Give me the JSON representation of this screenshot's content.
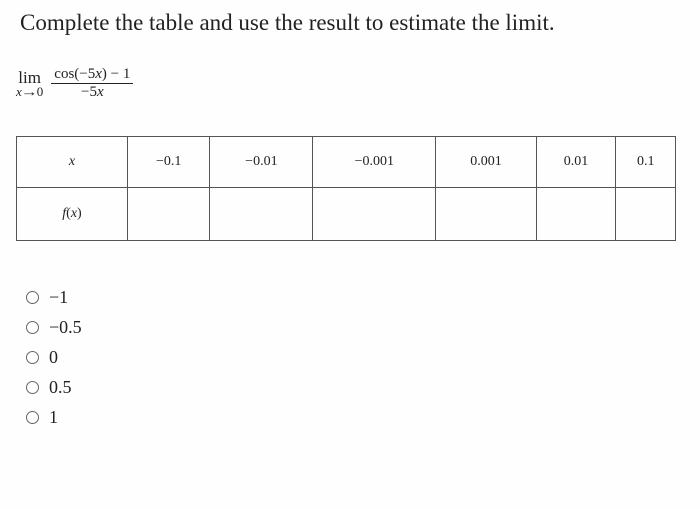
{
  "prompt": "Complete the table and use the result to estimate the limit.",
  "limit": {
    "lim_word": "lim",
    "lim_var": "x",
    "lim_arrow": "→",
    "lim_to": "0",
    "numerator_a": "cos(",
    "numerator_b": "−5",
    "numerator_c": "x",
    "numerator_d": ") − 1",
    "denominator_a": "−5",
    "denominator_b": "x"
  },
  "table": {
    "row_label_x": "x",
    "row_label_fx_a": "f",
    "row_label_fx_b": "(",
    "row_label_fx_c": "x",
    "row_label_fx_d": ")",
    "x_vals": [
      "−0.1",
      "−0.01",
      "−0.001",
      "0.001",
      "0.01",
      "0.1"
    ],
    "fx_vals": [
      "",
      "",
      "",
      "",
      "",
      ""
    ]
  },
  "options": [
    "−1",
    "−0.5",
    "0",
    "0.5",
    "1"
  ],
  "chart_data": {
    "type": "table",
    "columns": [
      "x",
      "-0.1",
      "-0.01",
      "-0.001",
      "0.001",
      "0.01",
      "0.1"
    ],
    "rows": [
      {
        "label": "f(x)",
        "values": [
          null,
          null,
          null,
          null,
          null,
          null
        ]
      }
    ],
    "function": "(cos(-5x) - 1) / (-5x)",
    "limit_variable": "x",
    "limit_approaches": 0,
    "answer_choices": [
      -1,
      -0.5,
      0,
      0.5,
      1
    ]
  }
}
